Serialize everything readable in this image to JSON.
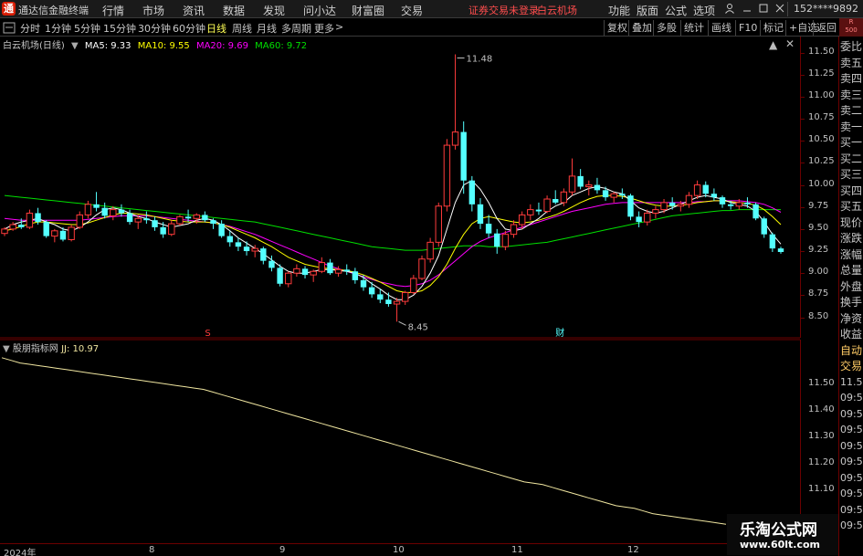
{
  "app": {
    "logo_text": "通",
    "title": "通达信金融终端"
  },
  "menu": [
    "行情",
    "市场",
    "资讯",
    "数据",
    "发现",
    "问小达",
    "财富圈",
    "交易"
  ],
  "status": {
    "trade_login": "证券交易未登录",
    "stock_name": "白云机场"
  },
  "right_menu": [
    "功能",
    "版面",
    "公式",
    "选项"
  ],
  "user_id": "152****9892",
  "toolbar": {
    "periods": [
      "分时",
      "1分钟",
      "5分钟",
      "15分钟",
      "30分钟",
      "60分钟",
      "日线",
      "周线",
      "月线",
      "多周期",
      "更多"
    ],
    "active_period": "日线",
    "more_arrow": ">",
    "right_buttons": [
      "复权",
      "叠加",
      "多股",
      "统计",
      "画线",
      "F10",
      "标记",
      "+自选",
      "返回"
    ],
    "r500_top": "R",
    "r500_bottom": "500"
  },
  "main_chart": {
    "stock_label": "白云机场(日线)",
    "ma_legend": [
      {
        "label": "MA5: 9.33",
        "color": "#ffffff"
      },
      {
        "label": "MA10: 9.55",
        "color": "#ffff00"
      },
      {
        "label": "MA20: 9.69",
        "color": "#ff00ff"
      },
      {
        "label": "MA60: 9.72",
        "color": "#00e000"
      }
    ],
    "high_label": "11.48",
    "low_label": "8.45",
    "marker_left": "S",
    "marker_right": "财"
  },
  "price_axis": [
    "11.50",
    "11.25",
    "11.00",
    "10.75",
    "10.50",
    "10.25",
    "10.00",
    "9.75",
    "9.50",
    "9.25",
    "9.00",
    "8.75",
    "8.50"
  ],
  "side_panel": [
    "委比",
    "卖五",
    "卖四",
    "卖三",
    "卖二",
    "卖一",
    "买一",
    "买二",
    "买三",
    "买四",
    "买五",
    "现价",
    "涨跌",
    "涨幅",
    "总量",
    "外盘",
    "换手",
    "净资",
    "收益",
    "自动",
    "交易",
    "11.50",
    "09:54",
    "09:54",
    "09:54",
    "09:54",
    "09:54",
    "09:54",
    "09:54",
    "09:54",
    "09:54"
  ],
  "lower_chart": {
    "indicator": "股朋指标网",
    "value_label": "JJ: 10.97",
    "axis": [
      "11.50",
      "11.40",
      "11.30",
      "11.20",
      "11.10"
    ]
  },
  "date_axis": [
    "2024年",
    "8",
    "9",
    "10",
    "11",
    "12"
  ],
  "watermark": {
    "title": "乐淘公式网",
    "url": "www.60lt.com"
  },
  "colors": {
    "up": "#ff3b3b",
    "down": "#54ffff",
    "ma5": "#ffffff",
    "ma10": "#ffff00",
    "ma20": "#ff00ff",
    "ma60": "#00e000",
    "jj": "#f0e6a0"
  },
  "chart_data": {
    "type": "candlestick",
    "candles": [
      [
        9.45,
        9.52,
        9.42,
        9.5
      ],
      [
        9.5,
        9.58,
        9.48,
        9.55
      ],
      [
        9.55,
        9.62,
        9.5,
        9.52
      ],
      [
        9.52,
        9.72,
        9.5,
        9.68
      ],
      [
        9.68,
        9.74,
        9.55,
        9.58
      ],
      [
        9.58,
        9.6,
        9.4,
        9.42
      ],
      [
        9.42,
        9.5,
        9.35,
        9.48
      ],
      [
        9.48,
        9.52,
        9.36,
        9.38
      ],
      [
        9.38,
        9.55,
        9.36,
        9.52
      ],
      [
        9.52,
        9.7,
        9.5,
        9.66
      ],
      [
        9.66,
        9.82,
        9.62,
        9.78
      ],
      [
        9.78,
        9.92,
        9.7,
        9.74
      ],
      [
        9.74,
        9.8,
        9.62,
        9.65
      ],
      [
        9.65,
        9.76,
        9.6,
        9.72
      ],
      [
        9.72,
        9.78,
        9.64,
        9.68
      ],
      [
        9.68,
        9.72,
        9.55,
        9.58
      ],
      [
        9.58,
        9.66,
        9.5,
        9.62
      ],
      [
        9.62,
        9.7,
        9.56,
        9.6
      ],
      [
        9.6,
        9.64,
        9.48,
        9.52
      ],
      [
        9.52,
        9.58,
        9.4,
        9.44
      ],
      [
        9.44,
        9.6,
        9.42,
        9.56
      ],
      [
        9.56,
        9.66,
        9.54,
        9.64
      ],
      [
        9.64,
        9.72,
        9.58,
        9.62
      ],
      [
        9.62,
        9.68,
        9.56,
        9.66
      ],
      [
        9.66,
        9.7,
        9.58,
        9.6
      ],
      [
        9.6,
        9.62,
        9.5,
        9.56
      ],
      [
        9.56,
        9.6,
        9.4,
        9.42
      ],
      [
        9.42,
        9.48,
        9.3,
        9.35
      ],
      [
        9.35,
        9.4,
        9.25,
        9.3
      ],
      [
        9.3,
        9.36,
        9.2,
        9.25
      ],
      [
        9.25,
        9.32,
        9.18,
        9.28
      ],
      [
        9.28,
        9.3,
        9.1,
        9.14
      ],
      [
        9.14,
        9.2,
        9.02,
        9.06
      ],
      [
        9.06,
        9.1,
        8.85,
        8.88
      ],
      [
        8.88,
        9.02,
        8.84,
        9.0
      ],
      [
        9.0,
        9.1,
        8.96,
        9.05
      ],
      [
        9.05,
        9.08,
        8.94,
        8.98
      ],
      [
        8.98,
        9.04,
        8.9,
        9.02
      ],
      [
        9.02,
        9.18,
        9.0,
        9.12
      ],
      [
        9.12,
        9.16,
        8.98,
        9.0
      ],
      [
        9.0,
        9.08,
        8.96,
        9.04
      ],
      [
        9.04,
        9.1,
        8.98,
        9.02
      ],
      [
        9.02,
        9.06,
        8.88,
        8.92
      ],
      [
        8.92,
        8.98,
        8.8,
        8.84
      ],
      [
        8.84,
        8.9,
        8.72,
        8.76
      ],
      [
        8.76,
        8.82,
        8.66,
        8.7
      ],
      [
        8.7,
        8.78,
        8.62,
        8.65
      ],
      [
        8.65,
        8.72,
        8.45,
        8.68
      ],
      [
        8.68,
        8.8,
        8.64,
        8.78
      ],
      [
        8.78,
        8.98,
        8.76,
        8.94
      ],
      [
        8.94,
        9.2,
        8.92,
        9.16
      ],
      [
        9.16,
        9.4,
        9.12,
        9.35
      ],
      [
        9.35,
        9.8,
        9.3,
        9.76
      ],
      [
        9.76,
        10.52,
        9.7,
        10.45
      ],
      [
        10.45,
        11.48,
        10.4,
        10.6
      ],
      [
        10.6,
        10.72,
        9.9,
        10.05
      ],
      [
        10.05,
        10.1,
        9.7,
        9.78
      ],
      [
        9.78,
        9.85,
        9.5,
        9.56
      ],
      [
        9.56,
        9.66,
        9.4,
        9.45
      ],
      [
        9.45,
        9.5,
        9.22,
        9.3
      ],
      [
        9.3,
        9.48,
        9.26,
        9.44
      ],
      [
        9.44,
        9.6,
        9.4,
        9.55
      ],
      [
        9.55,
        9.7,
        9.5,
        9.66
      ],
      [
        9.66,
        9.78,
        9.6,
        9.72
      ],
      [
        9.72,
        9.8,
        9.66,
        9.7
      ],
      [
        9.7,
        9.88,
        9.68,
        9.84
      ],
      [
        9.84,
        9.94,
        9.78,
        9.8
      ],
      [
        9.8,
        9.96,
        9.76,
        9.92
      ],
      [
        9.92,
        10.3,
        9.88,
        10.1
      ],
      [
        10.1,
        10.18,
        9.95,
        9.98
      ],
      [
        9.98,
        10.05,
        9.88,
        10.0
      ],
      [
        10.0,
        10.08,
        9.9,
        9.94
      ],
      [
        9.94,
        9.98,
        9.82,
        9.86
      ],
      [
        9.86,
        9.92,
        9.8,
        9.9
      ],
      [
        9.9,
        9.96,
        9.84,
        9.88
      ],
      [
        9.88,
        9.9,
        9.6,
        9.64
      ],
      [
        9.64,
        9.7,
        9.52,
        9.58
      ],
      [
        9.58,
        9.72,
        9.54,
        9.68
      ],
      [
        9.68,
        9.76,
        9.62,
        9.72
      ],
      [
        9.72,
        9.84,
        9.68,
        9.8
      ],
      [
        9.8,
        9.86,
        9.72,
        9.76
      ],
      [
        9.76,
        9.82,
        9.7,
        9.78
      ],
      [
        9.78,
        9.92,
        9.74,
        9.88
      ],
      [
        9.88,
        10.05,
        9.84,
        10.0
      ],
      [
        10.0,
        10.04,
        9.86,
        9.9
      ],
      [
        9.9,
        9.96,
        9.82,
        9.86
      ],
      [
        9.86,
        9.88,
        9.74,
        9.78
      ],
      [
        9.78,
        9.82,
        9.72,
        9.76
      ],
      [
        9.76,
        9.84,
        9.72,
        9.8
      ],
      [
        9.8,
        9.86,
        9.74,
        9.78
      ],
      [
        9.78,
        9.8,
        9.6,
        9.62
      ],
      [
        9.62,
        9.64,
        9.4,
        9.44
      ],
      [
        9.44,
        9.46,
        9.24,
        9.28
      ],
      [
        9.28,
        9.3,
        9.22,
        9.24
      ]
    ],
    "ma5": [
      9.5,
      9.55,
      9.58,
      9.6,
      9.62,
      9.58,
      9.55,
      9.5,
      9.48,
      9.52,
      9.58,
      9.66,
      9.72,
      9.74,
      9.72,
      9.68,
      9.64,
      9.62,
      9.58,
      9.55,
      9.52,
      9.54,
      9.56,
      9.6,
      9.62,
      9.6,
      9.55,
      9.48,
      9.4,
      9.34,
      9.28,
      9.22,
      9.15,
      9.08,
      9.02,
      9.0,
      9.0,
      9.02,
      9.04,
      9.04,
      9.03,
      9.02,
      9.0,
      8.95,
      8.88,
      8.82,
      8.75,
      8.7,
      8.7,
      8.75,
      8.85,
      9.0,
      9.2,
      9.5,
      9.8,
      10.0,
      10.05,
      9.95,
      9.8,
      9.62,
      9.5,
      9.48,
      9.5,
      9.56,
      9.62,
      9.7,
      9.76,
      9.8,
      9.88,
      9.92,
      9.96,
      9.98,
      9.96,
      9.92,
      9.9,
      9.82,
      9.74,
      9.7,
      9.68,
      9.7,
      9.74,
      9.78,
      9.82,
      9.86,
      9.88,
      9.86,
      9.84,
      9.8,
      9.78,
      9.76,
      9.7,
      9.58,
      9.44,
      9.33
    ],
    "ma10": [
      9.48,
      9.5,
      9.53,
      9.56,
      9.58,
      9.58,
      9.57,
      9.56,
      9.55,
      9.55,
      9.57,
      9.6,
      9.63,
      9.66,
      9.68,
      9.68,
      9.67,
      9.66,
      9.64,
      9.62,
      9.6,
      9.59,
      9.58,
      9.58,
      9.58,
      9.57,
      9.55,
      9.52,
      9.48,
      9.44,
      9.4,
      9.35,
      9.3,
      9.24,
      9.18,
      9.14,
      9.1,
      9.08,
      9.06,
      9.05,
      9.04,
      9.03,
      9.01,
      8.98,
      8.94,
      8.9,
      8.85,
      8.8,
      8.78,
      8.78,
      8.8,
      8.86,
      8.96,
      9.1,
      9.28,
      9.44,
      9.56,
      9.62,
      9.64,
      9.62,
      9.6,
      9.58,
      9.57,
      9.58,
      9.6,
      9.63,
      9.66,
      9.7,
      9.75,
      9.8,
      9.84,
      9.87,
      9.88,
      9.88,
      9.87,
      9.85,
      9.82,
      9.79,
      9.77,
      9.76,
      9.76,
      9.77,
      9.78,
      9.8,
      9.81,
      9.82,
      9.82,
      9.81,
      9.8,
      9.79,
      9.77,
      9.72,
      9.64,
      9.55
    ],
    "ma20": [
      9.62,
      9.61,
      9.6,
      9.6,
      9.6,
      9.6,
      9.6,
      9.6,
      9.6,
      9.6,
      9.61,
      9.62,
      9.63,
      9.64,
      9.65,
      9.65,
      9.65,
      9.65,
      9.64,
      9.63,
      9.62,
      9.61,
      9.6,
      9.59,
      9.58,
      9.57,
      9.55,
      9.53,
      9.5,
      9.47,
      9.44,
      9.4,
      9.36,
      9.32,
      9.28,
      9.24,
      9.2,
      9.16,
      9.12,
      9.08,
      9.05,
      9.02,
      8.99,
      8.96,
      8.93,
      8.9,
      8.88,
      8.86,
      8.85,
      8.86,
      8.88,
      8.92,
      8.98,
      9.06,
      9.14,
      9.22,
      9.3,
      9.36,
      9.4,
      9.43,
      9.46,
      9.49,
      9.52,
      9.55,
      9.58,
      9.61,
      9.64,
      9.67,
      9.7,
      9.72,
      9.74,
      9.76,
      9.78,
      9.79,
      9.8,
      9.8,
      9.8,
      9.8,
      9.8,
      9.8,
      9.8,
      9.8,
      9.8,
      9.81,
      9.81,
      9.82,
      9.82,
      9.82,
      9.82,
      9.81,
      9.8,
      9.78,
      9.74,
      9.69
    ],
    "ma60": [
      9.88,
      9.87,
      9.86,
      9.85,
      9.84,
      9.83,
      9.82,
      9.81,
      9.8,
      9.79,
      9.78,
      9.77,
      9.76,
      9.75,
      9.74,
      9.73,
      9.72,
      9.71,
      9.7,
      9.69,
      9.68,
      9.67,
      9.66,
      9.65,
      9.64,
      9.63,
      9.62,
      9.61,
      9.6,
      9.59,
      9.58,
      9.56,
      9.54,
      9.52,
      9.5,
      9.48,
      9.46,
      9.44,
      9.42,
      9.4,
      9.38,
      9.36,
      9.34,
      9.32,
      9.3,
      9.29,
      9.28,
      9.27,
      9.26,
      9.26,
      9.26,
      9.27,
      9.28,
      9.29,
      9.3,
      9.31,
      9.31,
      9.31,
      9.3,
      9.3,
      9.3,
      9.31,
      9.32,
      9.33,
      9.34,
      9.35,
      9.37,
      9.39,
      9.41,
      9.43,
      9.45,
      9.47,
      9.49,
      9.51,
      9.53,
      9.55,
      9.57,
      9.59,
      9.61,
      9.63,
      9.65,
      9.66,
      9.67,
      9.68,
      9.69,
      9.7,
      9.71,
      9.71,
      9.72,
      9.72,
      9.72,
      9.72,
      9.72,
      9.72
    ],
    "jj": [
      11.6,
      11.59,
      11.58,
      11.575,
      11.57,
      11.565,
      11.56,
      11.555,
      11.55,
      11.545,
      11.54,
      11.535,
      11.53,
      11.525,
      11.52,
      11.515,
      11.51,
      11.505,
      11.5,
      11.495,
      11.49,
      11.485,
      11.48,
      11.47,
      11.46,
      11.45,
      11.44,
      11.43,
      11.42,
      11.41,
      11.4,
      11.39,
      11.38,
      11.37,
      11.36,
      11.35,
      11.34,
      11.33,
      11.32,
      11.31,
      11.3,
      11.29,
      11.28,
      11.27,
      11.26,
      11.25,
      11.24,
      11.23,
      11.22,
      11.21,
      11.2,
      11.19,
      11.18,
      11.17,
      11.16,
      11.15,
      11.14,
      11.13,
      11.125,
      11.12,
      11.11,
      11.1,
      11.09,
      11.08,
      11.07,
      11.06,
      11.05,
      11.04,
      11.035,
      11.03,
      11.02,
      11.01,
      11.005,
      11.0,
      10.995,
      10.99,
      10.985,
      10.98,
      10.975,
      10.97
    ],
    "ylim": [
      8.35,
      11.62
    ],
    "jj_ylim": [
      10.95,
      11.62
    ]
  }
}
